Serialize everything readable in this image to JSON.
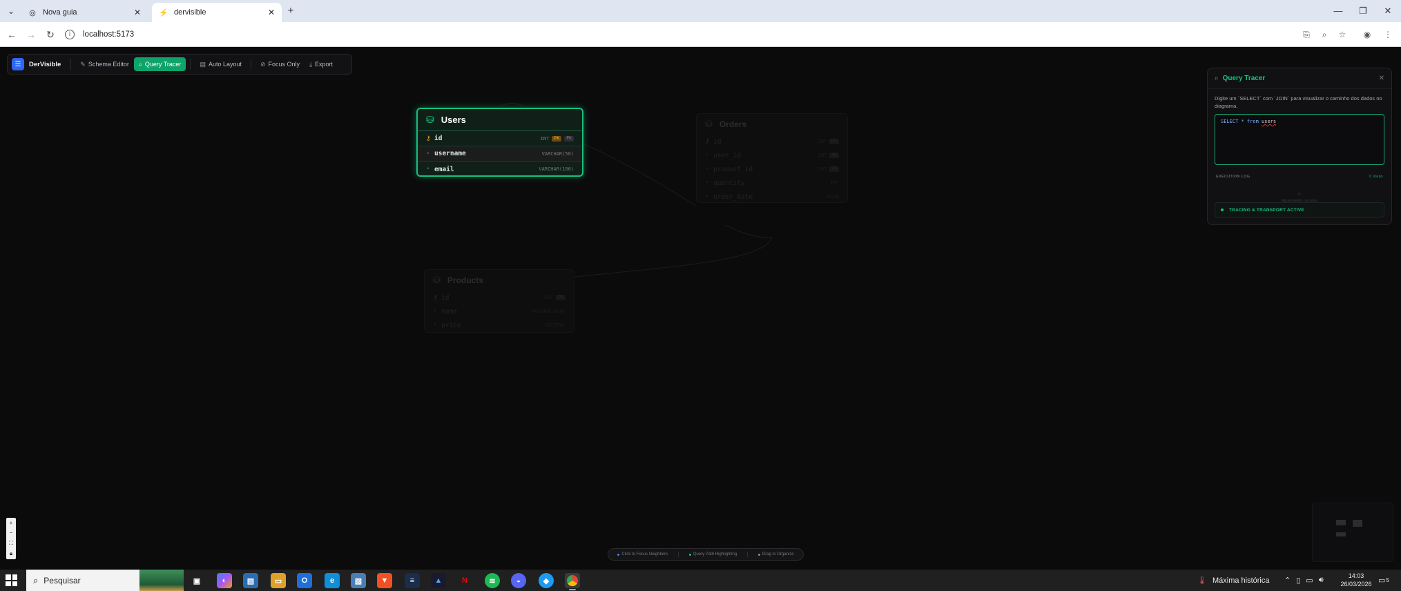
{
  "browser": {
    "tabs": [
      {
        "title": "Nova guia",
        "active": false
      },
      {
        "title": "dervisible",
        "active": true
      }
    ],
    "url": "localhost:5173"
  },
  "app": {
    "brand": "DerVisible",
    "toolbar": {
      "schema_editor": "Schema Editor",
      "query_tracer": "Query Tracer",
      "auto_layout": "Auto Layout",
      "focus_only": "Focus Only",
      "export": "Export"
    },
    "tables": {
      "users": {
        "name": "Users",
        "columns": [
          {
            "name": "id",
            "type": "INT",
            "pk": "PK",
            "fk": "FK"
          },
          {
            "name": "username",
            "type": "VARCHAR(50)"
          },
          {
            "name": "email",
            "type": "VARCHAR(100)"
          }
        ]
      },
      "orders": {
        "name": "Orders",
        "columns": [
          {
            "name": "id",
            "type": "INT",
            "pk": "PK"
          },
          {
            "name": "user_id",
            "type": "INT",
            "fk": "FK"
          },
          {
            "name": "product_id",
            "type": "INT",
            "fk": "FK"
          },
          {
            "name": "quantity",
            "type": "INT"
          },
          {
            "name": "order_date",
            "type": "DATE"
          }
        ]
      },
      "products": {
        "name": "Products",
        "columns": [
          {
            "name": "id",
            "type": "INT",
            "pk": "PK"
          },
          {
            "name": "name",
            "type": "VARCHAR(100)"
          },
          {
            "name": "price",
            "type": "DECIMAL"
          }
        ]
      }
    },
    "query_tracer": {
      "title": "Query Tracer",
      "description": "Digite um `SELECT` com `JOIN` para visualizar o caminho dos dados no diagrama.",
      "query_keyword": "SELECT * from",
      "query_table": "users",
      "log_label": "EXECUTION LOG",
      "log_steps": "0 steps",
      "empty_text": "Aguardando consulta",
      "status": "TRACING & TRANSPORT ACTIVE"
    },
    "hints": [
      {
        "label": "Click to Focus Neighbors",
        "color": "#3b82f6"
      },
      {
        "label": "Query Path Highlighting",
        "color": "#17c37f"
      },
      {
        "label": "Drag to Organize",
        "color": "#8b8b94"
      }
    ],
    "colors": {
      "accent": "#17c37f",
      "brand": "#2f66f3"
    }
  },
  "taskbar": {
    "search_placeholder": "Pesquisar",
    "weather": "Máxima histórica",
    "time": "14:03",
    "date": "26/03/2026",
    "notification_count": "5"
  }
}
